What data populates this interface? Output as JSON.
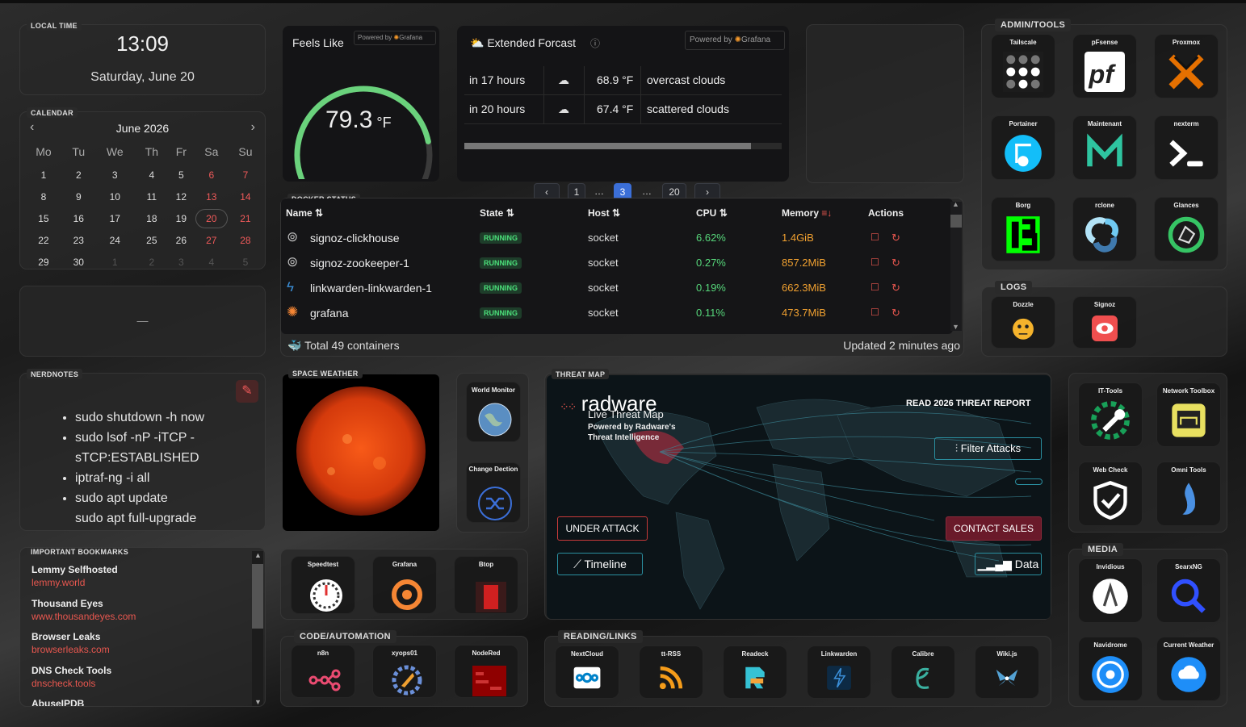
{
  "local_time": {
    "title": "LOCAL TIME",
    "time": "13:09",
    "date": "Saturday, June 20"
  },
  "calendar": {
    "title": "CALENDAR",
    "month": "June 2026",
    "days": [
      "Mo",
      "Tu",
      "We",
      "Th",
      "Fr",
      "Sa",
      "Su"
    ],
    "weeks": [
      [
        "1",
        "2",
        "3",
        "4",
        "5",
        "6",
        "7"
      ],
      [
        "8",
        "9",
        "10",
        "11",
        "12",
        "13",
        "14"
      ],
      [
        "15",
        "16",
        "17",
        "18",
        "19",
        "20",
        "21"
      ],
      [
        "22",
        "23",
        "24",
        "25",
        "26",
        "27",
        "28"
      ],
      [
        "29",
        "30",
        "1",
        "2",
        "3",
        "4",
        "5"
      ]
    ],
    "today": "20"
  },
  "empty_widget": {
    "text": "—"
  },
  "feels_like": {
    "title": "Feels Like",
    "powered": "Powered by",
    "brand": "Grafana",
    "value": "79.3",
    "unit": "°F",
    "gauge_fraction": 0.79
  },
  "forecast": {
    "title": "Extended Forcast",
    "powered": "Powered by",
    "brand": "Grafana",
    "rows": [
      {
        "when": "in 17 hours",
        "temp": "68.9 °F",
        "desc": "overcast clouds"
      },
      {
        "when": "in 20 hours",
        "temp": "67.4 °F",
        "desc": "scattered clouds"
      }
    ],
    "pages": [
      "1",
      "…",
      "3",
      "…",
      "20"
    ],
    "current_page": "3",
    "prev": "‹",
    "next": "›"
  },
  "docker": {
    "title": "DOCKER STATUS",
    "headers": {
      "name": "Name",
      "state": "State",
      "host": "Host",
      "cpu": "CPU",
      "memory": "Memory",
      "actions": "Actions"
    },
    "sort_icon": "⇅",
    "rows": [
      {
        "name": "signoz-clickhouse",
        "state": "RUNNING",
        "host": "socket",
        "cpu": "6.62%",
        "mem": "1.4GiB"
      },
      {
        "name": "signoz-zookeeper-1",
        "state": "RUNNING",
        "host": "socket",
        "cpu": "0.27%",
        "mem": "857.2MiB"
      },
      {
        "name": "linkwarden-linkwarden-1",
        "state": "RUNNING",
        "host": "socket",
        "cpu": "0.19%",
        "mem": "662.3MiB"
      },
      {
        "name": "grafana",
        "state": "RUNNING",
        "host": "socket",
        "cpu": "0.11%",
        "mem": "473.7MiB"
      }
    ],
    "total": "Total 49 containers",
    "updated": "Updated 2 minutes ago"
  },
  "nerdnotes": {
    "title": "NERDNOTES",
    "items": [
      "sudo shutdown -h now",
      "sudo lsof -nP -iTCP -",
      "sTCP:ESTABLISHED",
      "iptraf-ng -i all",
      "sudo apt update",
      "sudo apt full-upgrade"
    ]
  },
  "bookmarks": {
    "title": "IMPORTANT BOOKMARKS",
    "items": [
      {
        "name": "Lemmy Selfhosted",
        "url": "lemmy.world"
      },
      {
        "name": "Thousand Eyes",
        "url": "www.thousandeyes.com"
      },
      {
        "name": "Browser Leaks",
        "url": "browserleaks.com"
      },
      {
        "name": "DNS Check Tools",
        "url": "dnscheck.tools"
      },
      {
        "name": "AbuseIPDB",
        "url": ""
      }
    ]
  },
  "space_weather": {
    "title": "SPACE WEATHER"
  },
  "side_tiles": {
    "world_monitor": "World Monitor",
    "change_detection": "Change Dection"
  },
  "monitor_tiles": {
    "speedtest": "Speedtest",
    "grafana": "Grafana",
    "btop": "Btop"
  },
  "threat_map": {
    "title": "THREAT MAP",
    "brand": "radware",
    "subtitle": "Live Threat Map",
    "powered": "Powered by Radware's",
    "powered2": "Threat Intelligence",
    "report": "READ 2026 THREAT REPORT",
    "filter": "Filter Attacks",
    "under_attack": "UNDER ATTACK",
    "contact": "CONTACT SALES",
    "timeline": "Timeline",
    "data": "Data"
  },
  "code": {
    "title": "CODE/AUTOMATION",
    "items": [
      "n8n",
      "xyops01",
      "NodeRed"
    ]
  },
  "reading": {
    "title": "READING/LINKS",
    "items": [
      "NextCloud",
      "tt-RSS",
      "Readeck",
      "Linkwarden",
      "Calibre",
      "Wiki.js"
    ]
  },
  "admin": {
    "title": "ADMIN/TOOLS",
    "items": [
      "Tailscale",
      "pFsense",
      "Proxmox",
      "Portainer",
      "Maintenant",
      "nexterm",
      "Borg",
      "rclone",
      "Glances"
    ]
  },
  "logs": {
    "title": "LOGS",
    "items": [
      "Dozzle",
      "Signoz"
    ]
  },
  "tools": {
    "items": [
      "IT-Tools",
      "Network Toolbox",
      "Web Check",
      "Omni Tools"
    ]
  },
  "media": {
    "title": "MEDIA",
    "items": [
      "Invidious",
      "SearxNG",
      "Navidrome",
      "Current Weather"
    ]
  },
  "colors": {
    "accent": "#3b6fd8",
    "danger": "#e8574f",
    "running": "#4be07a",
    "cpu": "#56d67a",
    "mem": "#f0a030"
  }
}
